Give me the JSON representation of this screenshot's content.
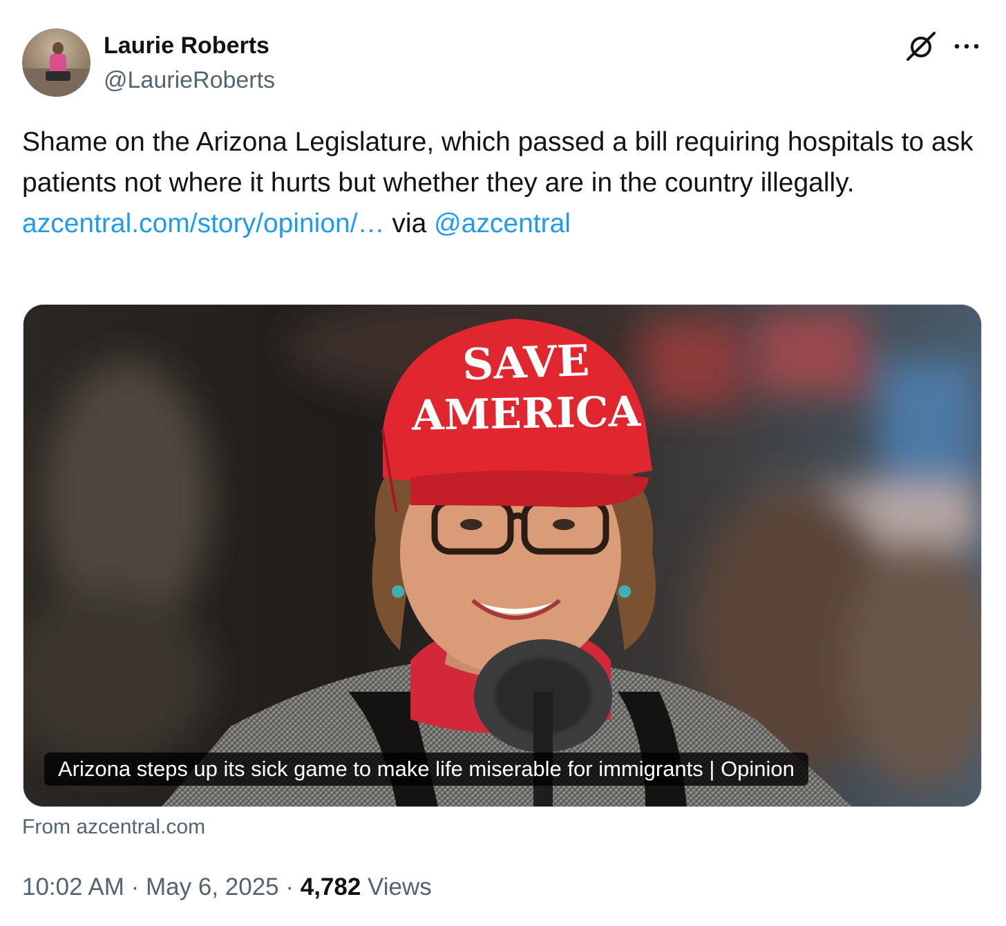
{
  "author": {
    "display_name": "Laurie Roberts",
    "handle": "@LaurieRoberts"
  },
  "header_icons": {
    "grok": "grok-icon",
    "more": "more-horizontal-icon"
  },
  "tweet": {
    "text": "Shame on the Arizona Legislature, which passed a bill requiring hospitals to ask patients not where it hurts but whether they are in the country illegally.",
    "link_text": "azcentral.com/story/opinion/…",
    "via_text": " via ",
    "mention": "@azcentral"
  },
  "card": {
    "hat_line1": "SAVE",
    "hat_line2": "AMERICA",
    "caption": "Arizona steps up its sick game to make life miserable for immigrants | Opinion",
    "source": "From azcentral.com"
  },
  "meta": {
    "time": "10:02 AM",
    "separator": " · ",
    "date": "May 6, 2025",
    "views_count": "4,782",
    "views_label": " Views"
  },
  "colors": {
    "link": "#1d9bf0",
    "secondary_text": "#536471",
    "primary_text": "#0f1419",
    "hat_red": "#e0262f"
  }
}
